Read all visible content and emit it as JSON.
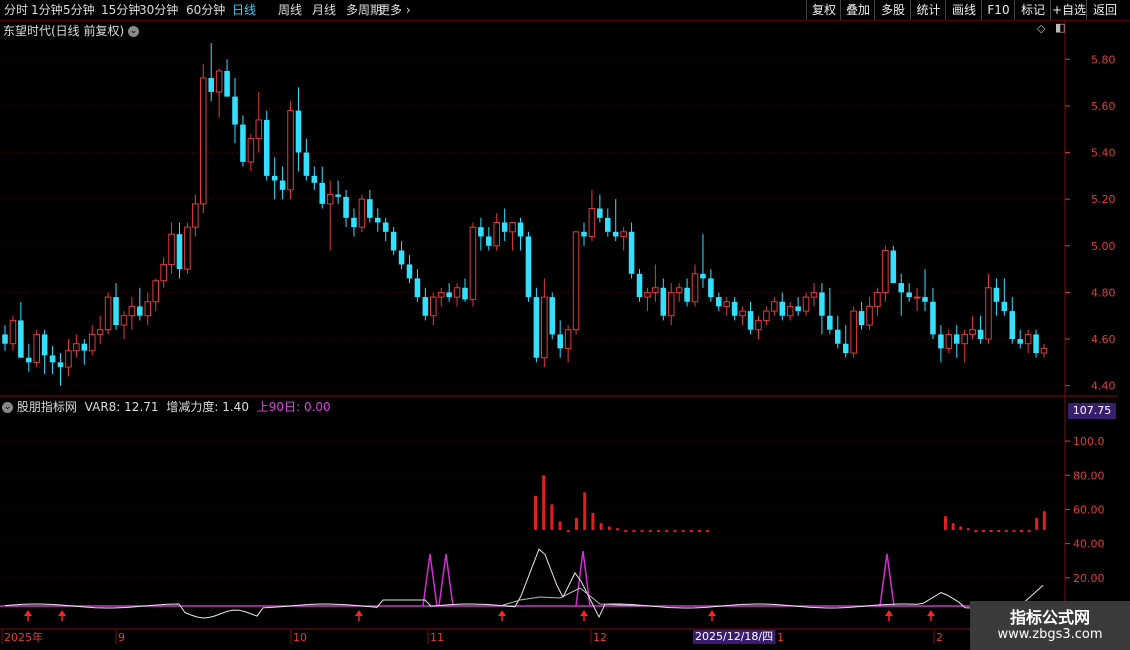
{
  "toolbar": {
    "periods": [
      "分时",
      "1分钟",
      "5分钟",
      "15分钟",
      "30分钟",
      "60分钟",
      "日线",
      "周线",
      "月线",
      "多周期",
      "更多"
    ],
    "active_period": "日线",
    "right_buttons": [
      "复权",
      "叠加",
      "多股",
      "统计",
      "画线",
      "F10",
      "标记",
      "+自选",
      "返回"
    ]
  },
  "main_chart": {
    "title": "东望时代(日线 前复权)",
    "y_ticks": [
      "5.80",
      "5.60",
      "5.40",
      "5.20",
      "5.00",
      "4.80",
      "4.60",
      "4.40"
    ],
    "colors": {
      "up": "#e03c3c",
      "down": "#33e0ff",
      "grid": "#3a0000",
      "axis": "#e03c3c"
    }
  },
  "indicator": {
    "name": "股朋指标网",
    "var8_label": "VAR8:",
    "var8_value": "12.71",
    "force_label": "增减力度:",
    "force_value": "1.40",
    "up90_label": "上90日:",
    "up90_value": "0.00",
    "current_value": "107.75",
    "y_ticks": [
      "100.0",
      "80.00",
      "60.00",
      "40.00",
      "20.00"
    ]
  },
  "date_axis": {
    "labels": [
      "2025年",
      "9",
      "10",
      "11",
      "12",
      "1",
      "2"
    ],
    "cursor_date": "2025/12/18/四"
  },
  "watermark": {
    "title": "指标公式网",
    "url": "www.zbgs3.com"
  },
  "chart_data": {
    "type": "candlestick",
    "ylim": [
      4.36,
      5.9
    ],
    "candles": [
      [
        4.62,
        4.66,
        4.55,
        4.58
      ],
      [
        4.58,
        4.7,
        4.55,
        4.68
      ],
      [
        4.68,
        4.76,
        4.52,
        4.52
      ],
      [
        4.52,
        4.58,
        4.46,
        4.5
      ],
      [
        4.5,
        4.64,
        4.48,
        4.62
      ],
      [
        4.62,
        4.64,
        4.45,
        4.53
      ],
      [
        4.53,
        4.57,
        4.45,
        4.5
      ],
      [
        4.5,
        4.54,
        4.4,
        4.48
      ],
      [
        4.48,
        4.6,
        4.44,
        4.55
      ],
      [
        4.55,
        4.62,
        4.52,
        4.58
      ],
      [
        4.58,
        4.6,
        4.49,
        4.55
      ],
      [
        4.55,
        4.66,
        4.53,
        4.62
      ],
      [
        4.62,
        4.7,
        4.58,
        4.64
      ],
      [
        4.64,
        4.8,
        4.62,
        4.78
      ],
      [
        4.78,
        4.84,
        4.64,
        4.66
      ],
      [
        4.66,
        4.72,
        4.6,
        4.7
      ],
      [
        4.7,
        4.78,
        4.64,
        4.74
      ],
      [
        4.74,
        4.82,
        4.68,
        4.7
      ],
      [
        4.7,
        4.8,
        4.66,
        4.76
      ],
      [
        4.76,
        4.86,
        4.72,
        4.85
      ],
      [
        4.85,
        4.95,
        4.82,
        4.92
      ],
      [
        4.92,
        5.1,
        4.88,
        5.05
      ],
      [
        5.05,
        5.1,
        4.86,
        4.9
      ],
      [
        4.9,
        5.1,
        4.88,
        5.08
      ],
      [
        5.08,
        5.22,
        5.04,
        5.18
      ],
      [
        5.18,
        5.78,
        5.14,
        5.72
      ],
      [
        5.72,
        5.87,
        5.62,
        5.66
      ],
      [
        5.66,
        5.76,
        5.55,
        5.75
      ],
      [
        5.75,
        5.8,
        5.64,
        5.64
      ],
      [
        5.64,
        5.72,
        5.44,
        5.52
      ],
      [
        5.52,
        5.56,
        5.34,
        5.36
      ],
      [
        5.36,
        5.48,
        5.32,
        5.46
      ],
      [
        5.46,
        5.66,
        5.4,
        5.54
      ],
      [
        5.54,
        5.58,
        5.28,
        5.3
      ],
      [
        5.3,
        5.38,
        5.2,
        5.28
      ],
      [
        5.28,
        5.34,
        5.2,
        5.24
      ],
      [
        5.24,
        5.62,
        5.2,
        5.58
      ],
      [
        5.58,
        5.68,
        5.32,
        5.4
      ],
      [
        5.4,
        5.46,
        5.28,
        5.3
      ],
      [
        5.3,
        5.34,
        5.24,
        5.27
      ],
      [
        5.27,
        5.34,
        5.16,
        5.18
      ],
      [
        5.18,
        5.28,
        4.98,
        5.22
      ],
      [
        5.22,
        5.28,
        5.18,
        5.21
      ],
      [
        5.21,
        5.24,
        5.08,
        5.12
      ],
      [
        5.12,
        5.16,
        5.04,
        5.08
      ],
      [
        5.08,
        5.22,
        5.06,
        5.2
      ],
      [
        5.2,
        5.24,
        5.1,
        5.12
      ],
      [
        5.12,
        5.16,
        5.06,
        5.1
      ],
      [
        5.1,
        5.12,
        5.02,
        5.06
      ],
      [
        5.06,
        5.08,
        4.96,
        4.98
      ],
      [
        4.98,
        5.02,
        4.9,
        4.92
      ],
      [
        4.92,
        4.96,
        4.84,
        4.86
      ],
      [
        4.86,
        4.9,
        4.76,
        4.78
      ],
      [
        4.78,
        4.82,
        4.68,
        4.7
      ],
      [
        4.7,
        4.8,
        4.66,
        4.78
      ],
      [
        4.78,
        4.82,
        4.74,
        4.8
      ],
      [
        4.8,
        4.84,
        4.76,
        4.78
      ],
      [
        4.78,
        4.84,
        4.74,
        4.82
      ],
      [
        4.82,
        4.86,
        4.76,
        4.77
      ],
      [
        4.77,
        5.1,
        4.74,
        5.08
      ],
      [
        5.08,
        5.12,
        4.98,
        5.04
      ],
      [
        5.04,
        5.08,
        4.98,
        5.0
      ],
      [
        5.0,
        5.14,
        4.98,
        5.1
      ],
      [
        5.1,
        5.16,
        5.02,
        5.06
      ],
      [
        5.06,
        5.08,
        4.98,
        5.1
      ],
      [
        5.1,
        5.12,
        4.98,
        5.04
      ],
      [
        5.04,
        5.06,
        4.76,
        4.78
      ],
      [
        4.78,
        4.82,
        4.5,
        4.52
      ],
      [
        4.52,
        4.86,
        4.48,
        4.78
      ],
      [
        4.78,
        4.8,
        4.6,
        4.62
      ],
      [
        4.62,
        4.68,
        4.52,
        4.56
      ],
      [
        4.56,
        4.66,
        4.5,
        4.64
      ],
      [
        4.64,
        5.06,
        4.62,
        5.06
      ],
      [
        5.06,
        5.1,
        5.0,
        5.04
      ],
      [
        5.04,
        5.24,
        5.02,
        5.16
      ],
      [
        5.16,
        5.22,
        5.1,
        5.12
      ],
      [
        5.12,
        5.16,
        5.04,
        5.06
      ],
      [
        5.06,
        5.2,
        5.02,
        5.04
      ],
      [
        5.04,
        5.08,
        4.98,
        5.06
      ],
      [
        5.06,
        5.1,
        4.86,
        4.88
      ],
      [
        4.88,
        4.9,
        4.76,
        4.78
      ],
      [
        4.78,
        4.82,
        4.72,
        4.8
      ],
      [
        4.8,
        4.92,
        4.76,
        4.82
      ],
      [
        4.82,
        4.86,
        4.68,
        4.7
      ],
      [
        4.7,
        4.84,
        4.66,
        4.8
      ],
      [
        4.8,
        4.84,
        4.76,
        4.82
      ],
      [
        4.82,
        4.86,
        4.74,
        4.76
      ],
      [
        4.76,
        4.92,
        4.74,
        4.88
      ],
      [
        4.88,
        5.05,
        4.82,
        4.86
      ],
      [
        4.86,
        4.9,
        4.76,
        4.78
      ],
      [
        4.78,
        4.8,
        4.72,
        4.74
      ],
      [
        4.74,
        4.78,
        4.7,
        4.76
      ],
      [
        4.76,
        4.78,
        4.68,
        4.7
      ],
      [
        4.7,
        4.74,
        4.66,
        4.72
      ],
      [
        4.72,
        4.76,
        4.62,
        4.64
      ],
      [
        4.64,
        4.7,
        4.6,
        4.68
      ],
      [
        4.68,
        4.74,
        4.66,
        4.72
      ],
      [
        4.72,
        4.78,
        4.7,
        4.76
      ],
      [
        4.76,
        4.8,
        4.68,
        4.7
      ],
      [
        4.7,
        4.76,
        4.68,
        4.74
      ],
      [
        4.74,
        4.78,
        4.7,
        4.72
      ],
      [
        4.72,
        4.8,
        4.7,
        4.78
      ],
      [
        4.78,
        4.84,
        4.74,
        4.8
      ],
      [
        4.8,
        4.84,
        4.62,
        4.7
      ],
      [
        4.7,
        4.82,
        4.62,
        4.64
      ],
      [
        4.64,
        4.7,
        4.56,
        4.58
      ],
      [
        4.58,
        4.66,
        4.52,
        4.54
      ],
      [
        4.54,
        4.74,
        4.52,
        4.72
      ],
      [
        4.72,
        4.76,
        4.64,
        4.66
      ],
      [
        4.66,
        4.78,
        4.64,
        4.74
      ],
      [
        4.74,
        4.82,
        4.7,
        4.8
      ],
      [
        4.8,
        5.0,
        4.76,
        4.98
      ],
      [
        4.98,
        5.0,
        4.84,
        4.84
      ],
      [
        4.84,
        4.88,
        4.7,
        4.8
      ],
      [
        4.8,
        4.84,
        4.76,
        4.78
      ],
      [
        4.78,
        4.82,
        4.72,
        4.78
      ],
      [
        4.78,
        4.9,
        4.72,
        4.76
      ],
      [
        4.76,
        4.82,
        4.6,
        4.62
      ],
      [
        4.62,
        4.66,
        4.5,
        4.56
      ],
      [
        4.56,
        4.64,
        4.54,
        4.62
      ],
      [
        4.62,
        4.66,
        4.52,
        4.58
      ],
      [
        4.58,
        4.64,
        4.5,
        4.62
      ],
      [
        4.62,
        4.7,
        4.6,
        4.64
      ],
      [
        4.64,
        4.7,
        4.58,
        4.6
      ],
      [
        4.6,
        4.88,
        4.58,
        4.82
      ],
      [
        4.82,
        4.86,
        4.7,
        4.76
      ],
      [
        4.76,
        4.86,
        4.7,
        4.72
      ],
      [
        4.72,
        4.78,
        4.58,
        4.6
      ],
      [
        4.6,
        4.64,
        4.56,
        4.58
      ],
      [
        4.58,
        4.64,
        4.54,
        4.62
      ],
      [
        4.62,
        4.64,
        4.52,
        4.54
      ],
      [
        4.54,
        4.58,
        4.52,
        4.56
      ]
    ],
    "indicator_bars_left": [
      68,
      80,
      63,
      53,
      47,
      55,
      70,
      58,
      52,
      50,
      49,
      48,
      48,
      48,
      48,
      48,
      48,
      48,
      48,
      48,
      48,
      48
    ],
    "indicator_bars_right": [
      56,
      52,
      50,
      49,
      48,
      48,
      48,
      48,
      48,
      48,
      48,
      48,
      55,
      59
    ]
  }
}
